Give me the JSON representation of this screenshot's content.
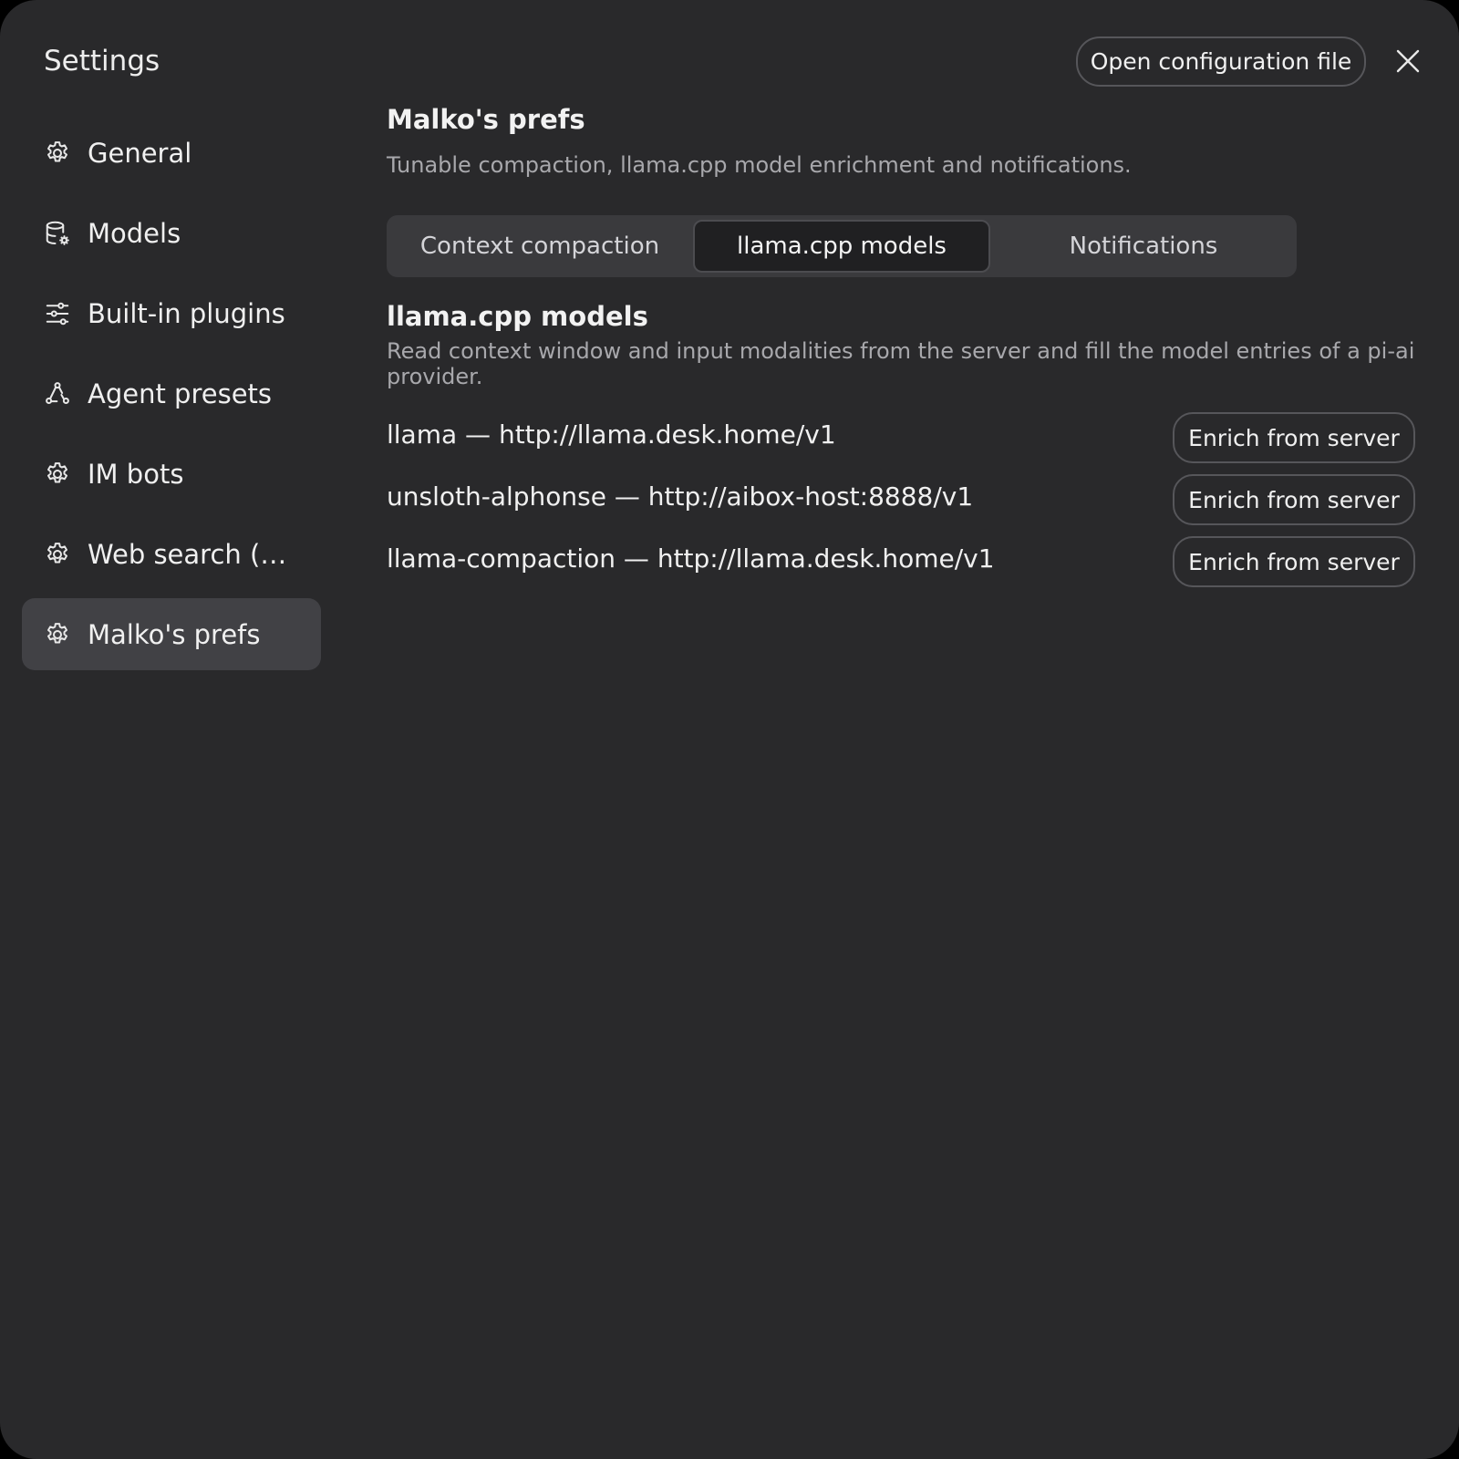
{
  "header": {
    "title": "Settings",
    "open_config_label": "Open configuration file",
    "close_icon": "close-icon"
  },
  "sidebar": {
    "items": [
      {
        "label": "General",
        "icon": "gear-icon",
        "active": false
      },
      {
        "label": "Models",
        "icon": "database-gear-icon",
        "active": false
      },
      {
        "label": "Built-in plugins",
        "icon": "sliders-icon",
        "active": false
      },
      {
        "label": "Agent presets",
        "icon": "nodes-icon",
        "active": false
      },
      {
        "label": "IM bots",
        "icon": "gear-icon",
        "active": false
      },
      {
        "label": "Web search (…",
        "icon": "gear-icon",
        "active": false
      },
      {
        "label": "Malko's prefs",
        "icon": "gear-icon",
        "active": true
      }
    ]
  },
  "main": {
    "title": "Malko's prefs",
    "description": "Tunable compaction, llama.cpp model enrichment and notifications.",
    "tabs": [
      {
        "label": "Context compaction",
        "selected": false
      },
      {
        "label": "llama.cpp models",
        "selected": true
      },
      {
        "label": "Notifications",
        "selected": false
      }
    ],
    "section": {
      "title": "llama.cpp models",
      "description": "Read context window and input modalities from the server and fill the model entries of a pi-ai provider."
    },
    "models": [
      {
        "text": "llama — http://llama.desk.home/v1",
        "button": "Enrich from server"
      },
      {
        "text": "unsloth-alphonse — http://aibox-host:8888/v1",
        "button": "Enrich from server"
      },
      {
        "text": "llama-compaction — http://llama.desk.home/v1",
        "button": "Enrich from server"
      }
    ]
  },
  "colors": {
    "background": "#29292b",
    "active_item": "#414145",
    "tab_bar": "#3a3a3d",
    "selected_tab": "#202022",
    "muted_text": "#a8a8ac"
  }
}
